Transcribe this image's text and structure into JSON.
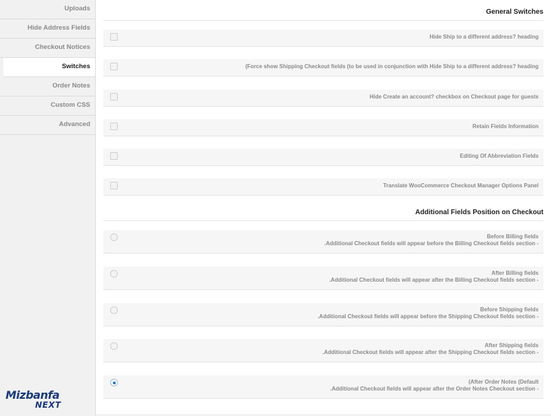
{
  "sidebar": {
    "items": [
      {
        "label": "Uploads",
        "active": false
      },
      {
        "label": "Hide Address Fields",
        "active": false
      },
      {
        "label": "Checkout Notices",
        "active": false
      },
      {
        "label": "Switches",
        "active": true
      },
      {
        "label": "Order Notes",
        "active": false
      },
      {
        "label": "Custom CSS",
        "active": false
      },
      {
        "label": "Advanced",
        "active": false
      }
    ]
  },
  "logo": {
    "brand": "Mizbanfa",
    "sub": "NEXT"
  },
  "general": {
    "title": "General Switches",
    "switches": [
      {
        "label": "Hide Ship to a different address? heading",
        "checked": false
      },
      {
        "label": "(Force show Shipping Checkout fields (to be used in conjunction with Hide Ship to a different address? heading",
        "checked": false
      },
      {
        "label": "Hide Create an account? checkbox on Checkout page for guests",
        "checked": false
      },
      {
        "label": "Retain Fields Information",
        "checked": false
      },
      {
        "label": "Editing Of Abbreviation Fields",
        "checked": false
      },
      {
        "label": "Translate WooCommerce Checkout Manager Options Panel",
        "checked": false
      }
    ]
  },
  "position": {
    "title": "Additional Fields Position on Checkout",
    "options": [
      {
        "title": "Before Billing fields",
        "desc": ".Additional Checkout fields will appear before the Billing Checkout fields section -",
        "selected": false
      },
      {
        "title": "After Billing fields",
        "desc": ".Additional Checkout fields will appear after the Billing Checkout fields section -",
        "selected": false
      },
      {
        "title": "Before Shipping fields",
        "desc": ".Additional Checkout fields will appear before the Shipping Checkout fields section -",
        "selected": false
      },
      {
        "title": "After Shipping fields",
        "desc": ".Additional Checkout fields will appear after the Shipping Checkout fields section -",
        "selected": false
      },
      {
        "title": "(After Order Notes (Default",
        "desc": ".Additional Checkout fields will appear after the Order Notes Checkout section -",
        "selected": true
      }
    ]
  }
}
